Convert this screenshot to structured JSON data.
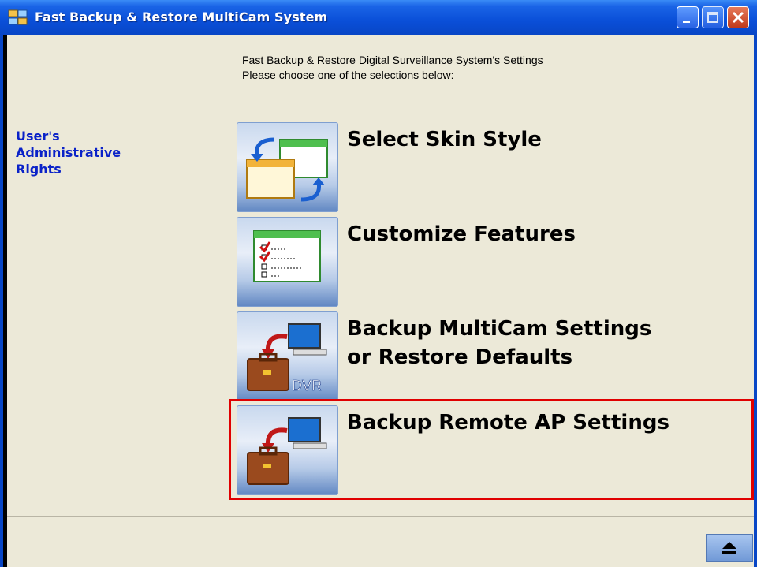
{
  "window": {
    "title": "Fast Backup & Restore MultiCam System"
  },
  "sidebar": {
    "link_label": "User's\nAdministrative\nRights"
  },
  "main": {
    "intro_line1": "Fast Backup & Restore Digital Surveillance System's Settings",
    "intro_line2": "Please choose one of the selections below:",
    "options": [
      {
        "label": "Select Skin Style",
        "icon": "skin-windows-icon"
      },
      {
        "label": "Customize Features",
        "icon": "checklist-window-icon"
      },
      {
        "label": "Backup MultiCam Settings\nor Restore Defaults",
        "icon": "briefcase-dvr-icon",
        "icon_text": "DVR"
      },
      {
        "label": "Backup Remote AP Settings",
        "icon": "briefcase-computer-icon",
        "highlighted": true
      }
    ]
  },
  "footer": {
    "eject_icon": "eject-icon"
  },
  "colors": {
    "titlebar": "#0a4fd8",
    "highlight": "#e00000",
    "link": "#0a22c8",
    "background": "#ece9d8"
  }
}
